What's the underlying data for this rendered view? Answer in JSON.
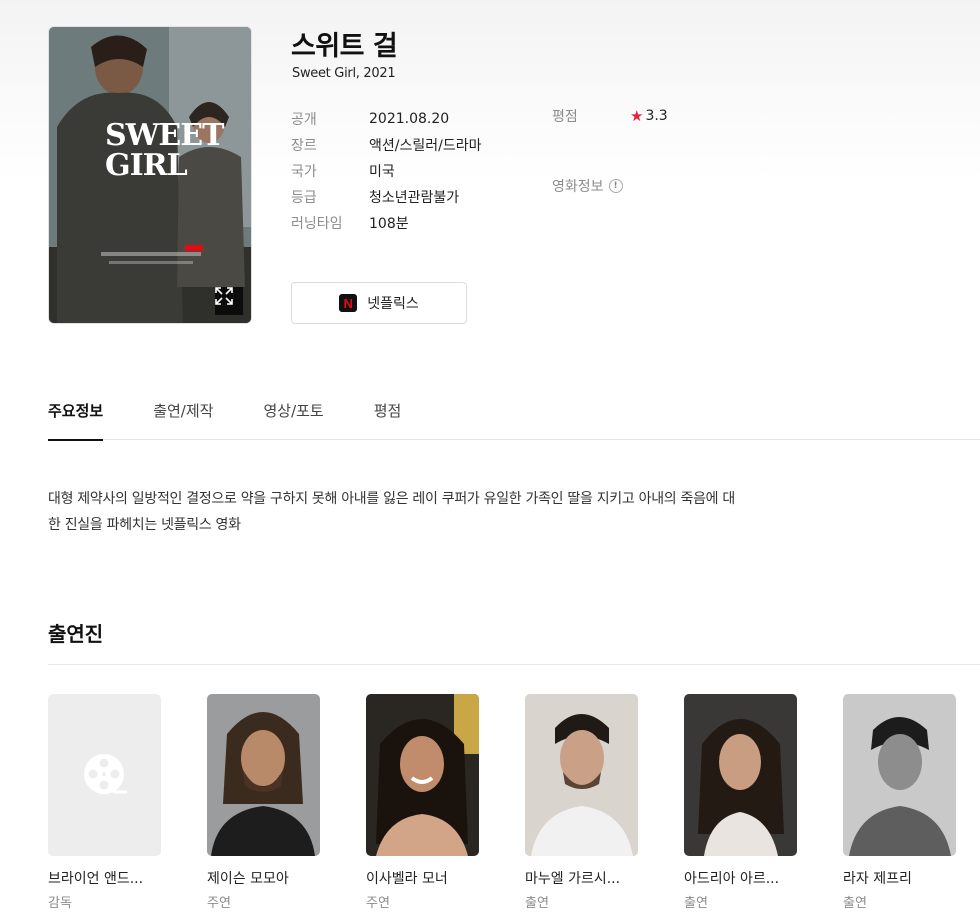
{
  "movie": {
    "title": "스위트 걸",
    "subtitle": "Sweet Girl, 2021",
    "poster_title_line1": "SWEET",
    "poster_title_line2": "GIRL",
    "details": [
      {
        "label": "공개",
        "value": "2021.08.20"
      },
      {
        "label": "장르",
        "value": "액션/스릴러/드라마"
      },
      {
        "label": "국가",
        "value": "미국"
      },
      {
        "label": "등급",
        "value": "청소년관람불가"
      },
      {
        "label": "러닝타임",
        "value": "108분"
      }
    ],
    "rating_label": "평점",
    "rating_value": "3.3",
    "movie_info_label": "영화정보",
    "stream_button": "넷플릭스",
    "netflix_letter": "N"
  },
  "tabs": [
    {
      "label": "주요정보"
    },
    {
      "label": "출연/제작"
    },
    {
      "label": "영상/포토"
    },
    {
      "label": "평점"
    }
  ],
  "synopsis": {
    "line1": "대형 제약사의 일방적인 결정으로 약을 구하지 못해 아내를 잃은 레이 쿠퍼가 유일한 가족인 딸을 지키고 아내의 죽음에 대",
    "line2": "한 진실을 파헤치는 넷플릭스 영화"
  },
  "cast": {
    "title": "출연진",
    "members": [
      {
        "name": "브라이언 앤드...",
        "role": "감독"
      },
      {
        "name": "제이슨 모모아",
        "role": "주연"
      },
      {
        "name": "이사벨라 모너",
        "role": "주연"
      },
      {
        "name": "마누엘 가르시...",
        "role": "출연"
      },
      {
        "name": "아드리아 아르...",
        "role": "출연"
      },
      {
        "name": "라자 제프리",
        "role": "출연"
      }
    ]
  },
  "colors": {
    "accent_star": "#e2243d",
    "netflix_red": "#e50914",
    "text_dark": "#111111",
    "text_muted": "#8c8c8c"
  }
}
